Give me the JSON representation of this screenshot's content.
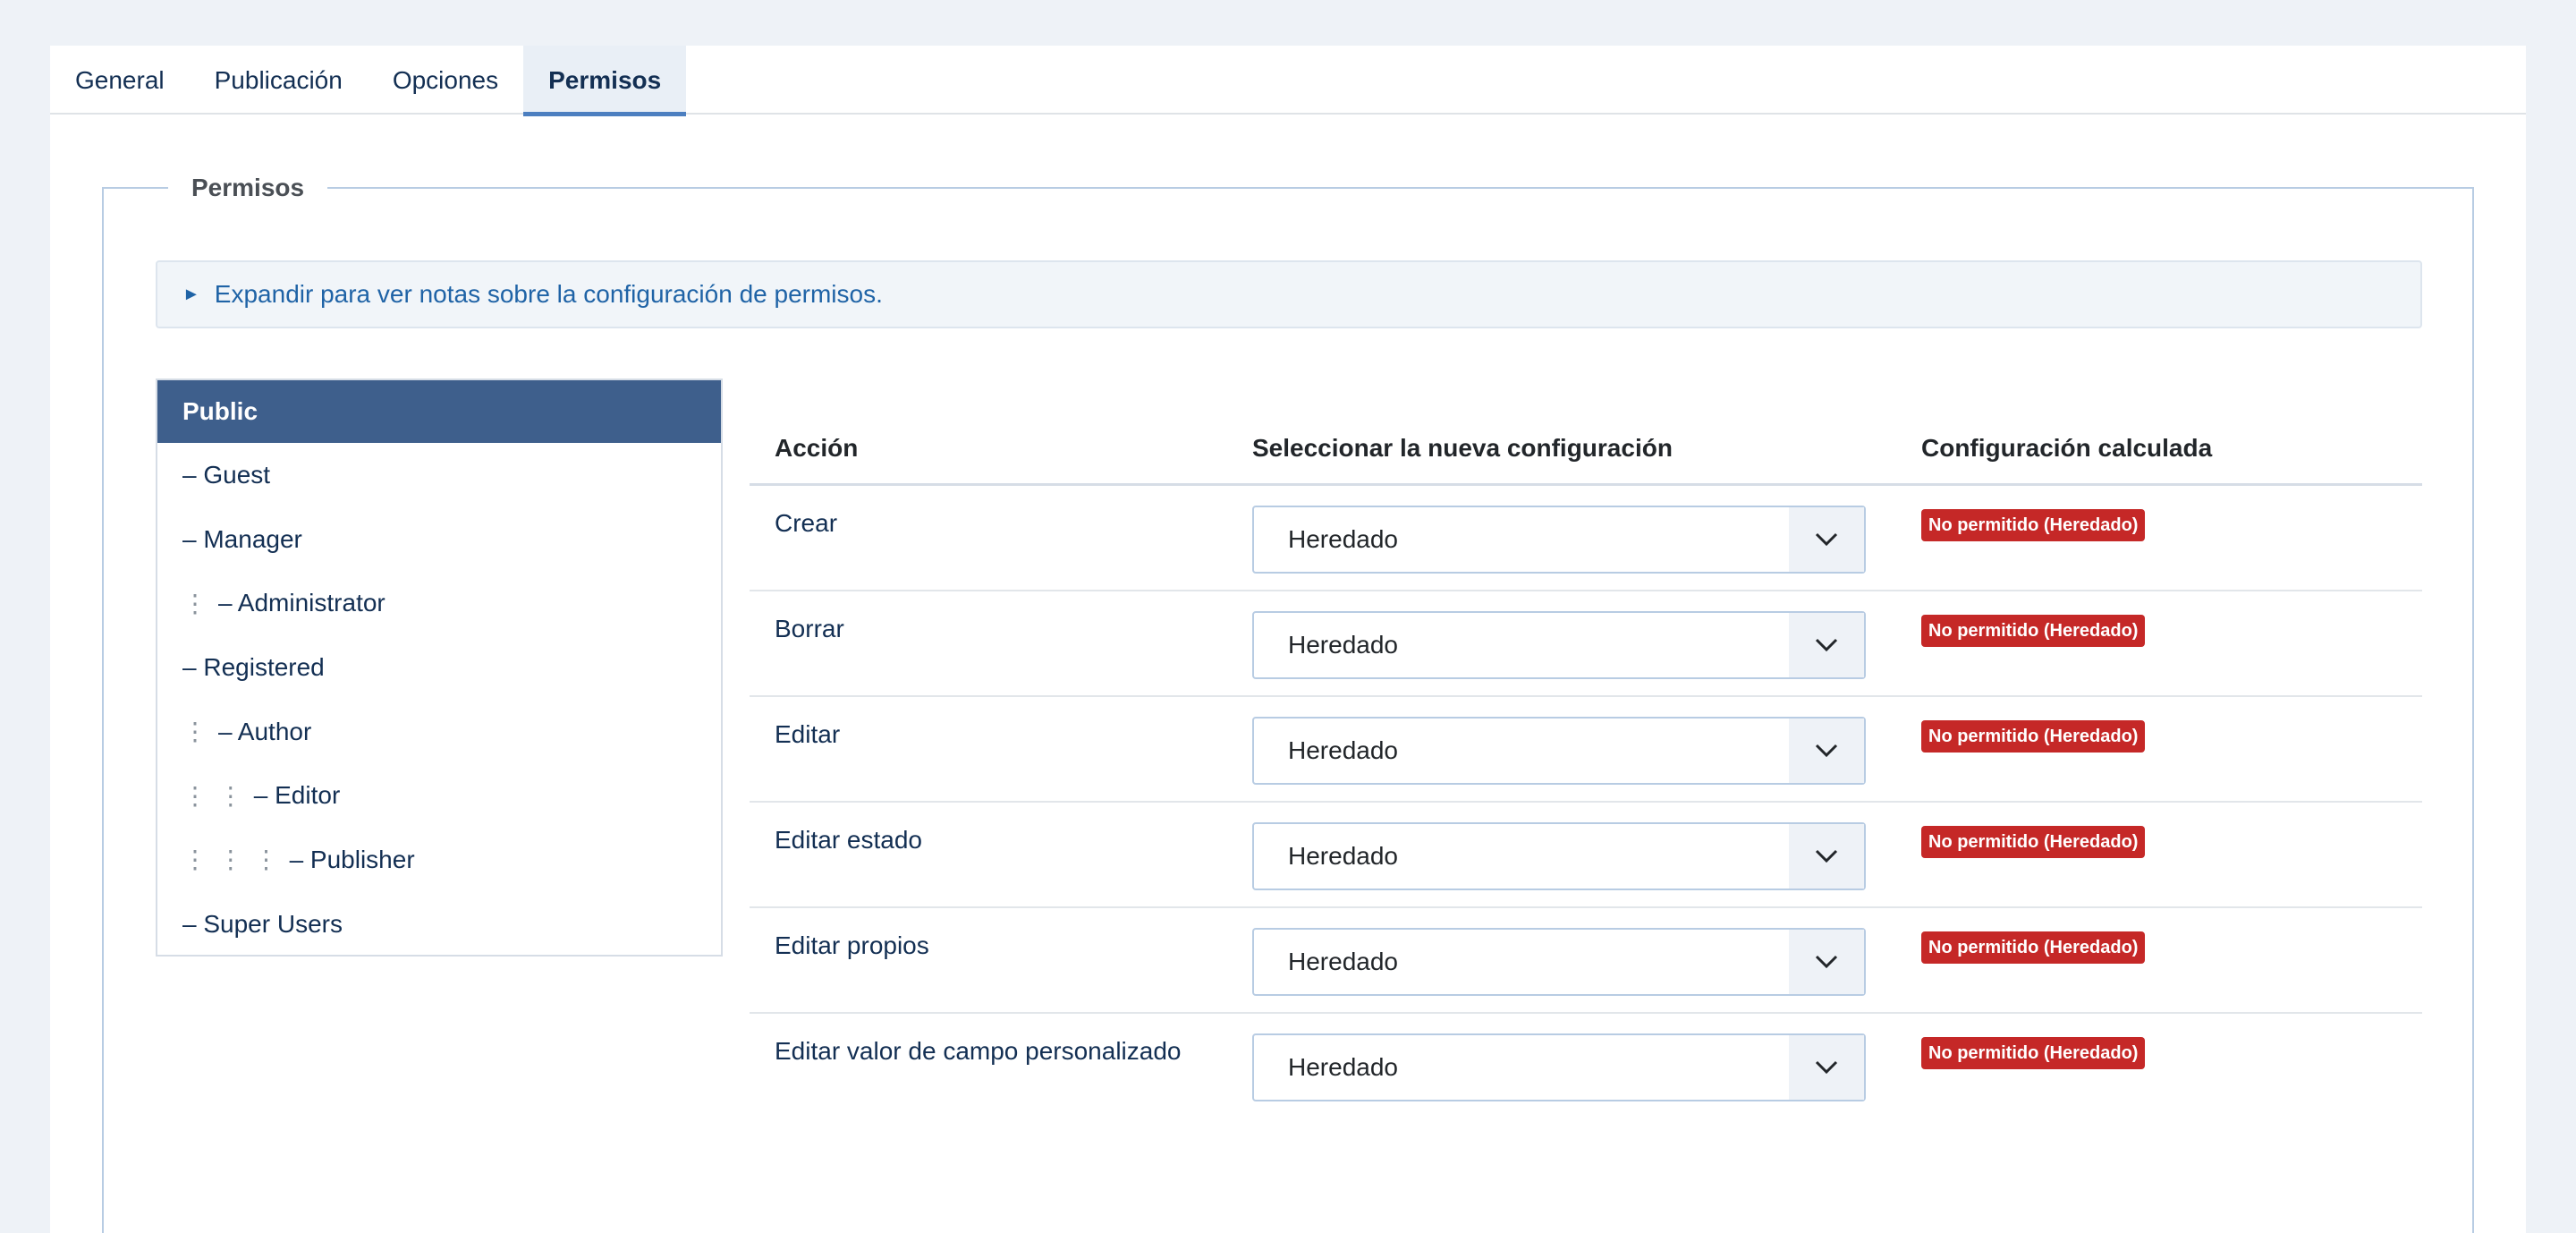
{
  "tabs": [
    {
      "label": "General"
    },
    {
      "label": "Publicación"
    },
    {
      "label": "Opciones"
    },
    {
      "label": "Permisos"
    }
  ],
  "fieldset": {
    "legend": "Permisos",
    "notes_toggle": "Expandir para ver notas sobre la configuración de permisos."
  },
  "groups": [
    {
      "label": "Public",
      "depth": 0
    },
    {
      "label": "– Guest",
      "depth": 0
    },
    {
      "label": "– Manager",
      "depth": 0
    },
    {
      "label": "– Administrator",
      "depth": 1
    },
    {
      "label": "– Registered",
      "depth": 0
    },
    {
      "label": "– Author",
      "depth": 1
    },
    {
      "label": "– Editor",
      "depth": 2
    },
    {
      "label": "– Publisher",
      "depth": 3
    },
    {
      "label": "– Super Users",
      "depth": 0
    }
  ],
  "table": {
    "headers": [
      "Acción",
      "Seleccionar la nueva configuración",
      "Configuración calculada"
    ],
    "rows": [
      {
        "action": "Crear",
        "setting": "Heredado",
        "computed": "No permitido (Heredado)"
      },
      {
        "action": "Borrar",
        "setting": "Heredado",
        "computed": "No permitido (Heredado)"
      },
      {
        "action": "Editar",
        "setting": "Heredado",
        "computed": "No permitido (Heredado)"
      },
      {
        "action": "Editar estado",
        "setting": "Heredado",
        "computed": "No permitido (Heredado)"
      },
      {
        "action": "Editar propios",
        "setting": "Heredado",
        "computed": "No permitido (Heredado)"
      },
      {
        "action": "Editar valor de campo personalizado",
        "setting": "Heredado",
        "computed": "No permitido (Heredado)"
      }
    ]
  },
  "colors": {
    "active_group": "#3e5f8c",
    "badge_danger": "#c52827",
    "tab_accent": "#4c7fc0",
    "link": "#1f63a6"
  }
}
